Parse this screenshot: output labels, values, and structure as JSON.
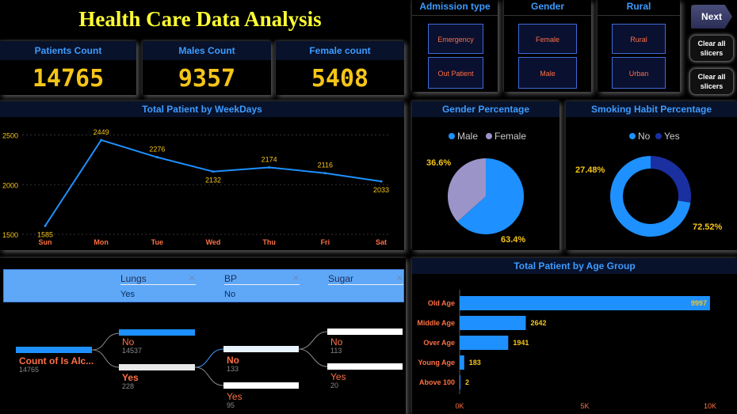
{
  "header": {
    "title": "Health Care Data Analysis"
  },
  "kpis": [
    {
      "label": "Patients Count",
      "value": "14765"
    },
    {
      "label": "Males Count",
      "value": "9357"
    },
    {
      "label": "Female count",
      "value": "5408"
    }
  ],
  "slicers": {
    "admission": {
      "label": "Admission type",
      "options": [
        "Emergency",
        "Out Patient"
      ]
    },
    "gender": {
      "label": "Gender",
      "options": [
        "Female",
        "Male"
      ]
    },
    "rural": {
      "label": "Rural",
      "options": [
        "Rural",
        "Urban"
      ]
    }
  },
  "buttons": {
    "next": "Next",
    "clear1": "Clear all slicers",
    "clear2": "Clear all slicers"
  },
  "filters": [
    {
      "label": "Lungs",
      "value": "Yes"
    },
    {
      "label": "BP",
      "value": "No"
    },
    {
      "label": "Sugar",
      "value": ""
    }
  ],
  "colors": {
    "accent": "#3d9bff",
    "kpi": "#f5c518",
    "label": "#ff7043",
    "line": "#1e90ff",
    "female": "#9b94c9",
    "smoke_yes": "#1a2fa0"
  },
  "chart_data": [
    {
      "type": "line",
      "title": "Total Patient by WeekDays",
      "categories": [
        "Sun",
        "Mon",
        "Tue",
        "Wed",
        "Thu",
        "Fri",
        "Sat"
      ],
      "values": [
        1585,
        2449,
        2276,
        2132,
        2174,
        2116,
        2033
      ],
      "ylim": [
        1500,
        2600
      ],
      "yticks": [
        "1500",
        "2000",
        "2500"
      ],
      "grid": true
    },
    {
      "type": "pie",
      "title": "Gender Percentage",
      "legend": [
        "Male",
        "Female"
      ],
      "values": [
        63.4,
        36.6
      ],
      "labels": [
        "63.4%",
        "36.6%"
      ],
      "legend_position": "top"
    },
    {
      "type": "pie",
      "subtype": "donut",
      "title": "Smoking Habit Percentage",
      "legend": [
        "No",
        "Yes"
      ],
      "values": [
        72.52,
        27.48
      ],
      "labels": [
        "72.52%",
        "27.48%"
      ],
      "legend_position": "top"
    },
    {
      "type": "bar",
      "orientation": "horizontal",
      "title": "Total Patient by Age Group",
      "categories": [
        "Old Age",
        "Middle Age",
        "Over Age",
        "Young Age",
        "Above 100"
      ],
      "values": [
        9997,
        2642,
        1941,
        183,
        2
      ],
      "labels": [
        "9997",
        "2642",
        "1941",
        "183",
        "2"
      ],
      "xlim": [
        0,
        10000
      ],
      "xticks": [
        "0K",
        "5K",
        "10K"
      ]
    },
    {
      "type": "table",
      "subtype": "decomposition-tree",
      "root": {
        "label": "Count of Is Alc...",
        "value": "14765"
      },
      "nodes": [
        {
          "label": "No",
          "value": "14537"
        },
        {
          "label": "Yes",
          "value": "228"
        },
        {
          "label": "No",
          "value": "133"
        },
        {
          "label": "Yes",
          "value": "95"
        },
        {
          "label": "No",
          "value": "113"
        },
        {
          "label": "Yes",
          "value": "20"
        }
      ]
    }
  ]
}
